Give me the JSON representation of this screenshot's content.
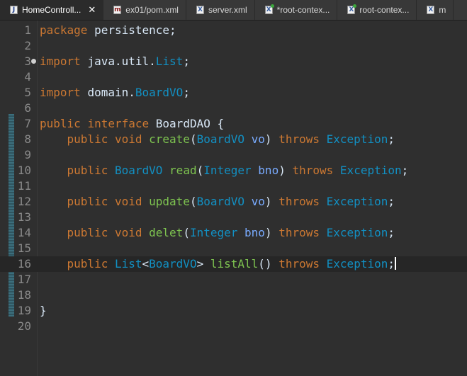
{
  "tabs": [
    {
      "label": "HomeControll...",
      "icon": "java-file-icon",
      "active": true,
      "close": "✕"
    },
    {
      "label": "ex01/pom.xml",
      "icon": "maven-file-icon",
      "active": false
    },
    {
      "label": "server.xml",
      "icon": "xml-file-icon",
      "active": false
    },
    {
      "label": "*root-contex...",
      "icon": "spring-xml-file-icon",
      "active": false
    },
    {
      "label": "root-contex...",
      "icon": "spring-xml-file-icon",
      "active": false
    },
    {
      "label": "m",
      "icon": "xml-file-icon",
      "active": false
    }
  ],
  "editor": {
    "current_line": 16,
    "lines": [
      {
        "n": "1",
        "t": "package persistence;"
      },
      {
        "n": "2",
        "t": ""
      },
      {
        "n": "3",
        "t": "import java.util.List;"
      },
      {
        "n": "4",
        "t": ""
      },
      {
        "n": "5",
        "t": "import domain.BoardVO;"
      },
      {
        "n": "6",
        "t": ""
      },
      {
        "n": "7",
        "t": "public interface BoardDAO {"
      },
      {
        "n": "8",
        "t": "    public void create(BoardVO vo) throws Exception;"
      },
      {
        "n": "9",
        "t": ""
      },
      {
        "n": "10",
        "t": "    public BoardVO read(Integer bno) throws Exception;"
      },
      {
        "n": "11",
        "t": ""
      },
      {
        "n": "12",
        "t": "    public void update(BoardVO vo) throws Exception;"
      },
      {
        "n": "13",
        "t": ""
      },
      {
        "n": "14",
        "t": "    public void delet(Integer bno) throws Exception;"
      },
      {
        "n": "15",
        "t": ""
      },
      {
        "n": "16",
        "t": "    public List<BoardVO> listAll() throws Exception;"
      },
      {
        "n": "17",
        "t": ""
      },
      {
        "n": "18",
        "t": ""
      },
      {
        "n": "19",
        "t": "}"
      },
      {
        "n": "20",
        "t": ""
      }
    ]
  },
  "colors": {
    "keyword": "#cc7832",
    "type": "#1290c3",
    "method": "#7ec450",
    "parameter": "#79abff",
    "text": "#d9e8f7"
  }
}
